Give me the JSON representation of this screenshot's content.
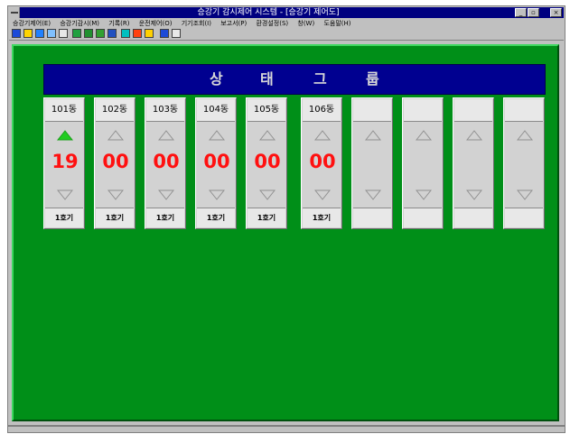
{
  "window": {
    "title": "승강기 감시제어 시스템 - [승강기 제어도]",
    "buttons": [
      "_",
      "▫",
      "×"
    ]
  },
  "menu": [
    "승강기제어(E)",
    "승강기감시(M)",
    "기록(R)",
    "운전제어(O)",
    "기기조회(I)",
    "보고서(P)",
    "환경설정(S)",
    "창(W)",
    "도움말(H)"
  ],
  "toolbar_icons": [
    "home-icon",
    "open-icon",
    "monitor-icon",
    "grid-icon",
    "print-icon",
    "save-icon",
    "chart-icon",
    "list-icon",
    "cube-icon",
    "help-icon",
    "stop-icon",
    "flag-icon",
    "window-icon",
    "tile-icon"
  ],
  "banner": {
    "letters": [
      "상",
      "태",
      "그",
      "룹"
    ]
  },
  "columns": [
    {
      "label": "101동",
      "floor": "19",
      "unit": "1호기",
      "direction": "up"
    },
    {
      "label": "102동",
      "floor": "00",
      "unit": "1호기",
      "direction": "none"
    },
    {
      "label": "103동",
      "floor": "00",
      "unit": "1호기",
      "direction": "none"
    },
    {
      "label": "104동",
      "floor": "00",
      "unit": "1호기",
      "direction": "none"
    },
    {
      "label": "105동",
      "floor": "00",
      "unit": "1호기",
      "direction": "none"
    },
    {
      "label": "106동",
      "floor": "00",
      "unit": "1호기",
      "direction": "none"
    },
    {
      "label": "",
      "floor": "",
      "unit": "",
      "direction": "none"
    },
    {
      "label": "",
      "floor": "",
      "unit": "",
      "direction": "none"
    },
    {
      "label": "",
      "floor": "",
      "unit": "",
      "direction": "none"
    },
    {
      "label": "",
      "floor": "",
      "unit": "",
      "direction": "none"
    }
  ],
  "colors": {
    "background": "#008f18",
    "banner": "#000090",
    "floor_text": "#ff1010",
    "arrow_active": "#22cc22",
    "arrow_idle": "#909090"
  }
}
